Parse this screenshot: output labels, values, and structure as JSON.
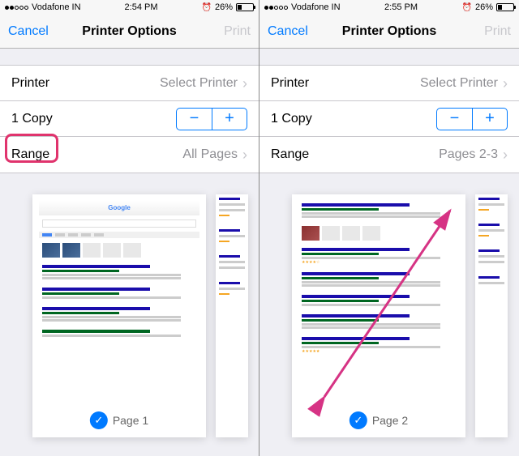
{
  "left": {
    "status": {
      "carrier": "Vodafone IN",
      "time": "2:54 PM",
      "battery_pct": "26%",
      "alarm": "⏰"
    },
    "nav": {
      "cancel": "Cancel",
      "title": "Printer Options",
      "print": "Print"
    },
    "rows": {
      "printer_label": "Printer",
      "printer_value": "Select Printer",
      "copies_label": "1 Copy",
      "range_label": "Range",
      "range_value": "All Pages"
    },
    "preview": {
      "page_label": "Page 1",
      "search_engine": "Google"
    }
  },
  "right": {
    "status": {
      "carrier": "Vodafone IN",
      "time": "2:55 PM",
      "battery_pct": "26%",
      "alarm": "⏰"
    },
    "nav": {
      "cancel": "Cancel",
      "title": "Printer Options",
      "print": "Print"
    },
    "rows": {
      "printer_label": "Printer",
      "printer_value": "Select Printer",
      "copies_label": "1 Copy",
      "range_label": "Range",
      "range_value": "Pages 2-3"
    },
    "preview": {
      "page_label": "Page 2"
    }
  },
  "icons": {
    "chevron": "›",
    "minus": "−",
    "plus": "+",
    "check": "✓"
  },
  "colors": {
    "tint": "#007aff",
    "disabled": "#c7c7cc",
    "highlight": "#e0336d",
    "arrow": "#d63384"
  }
}
